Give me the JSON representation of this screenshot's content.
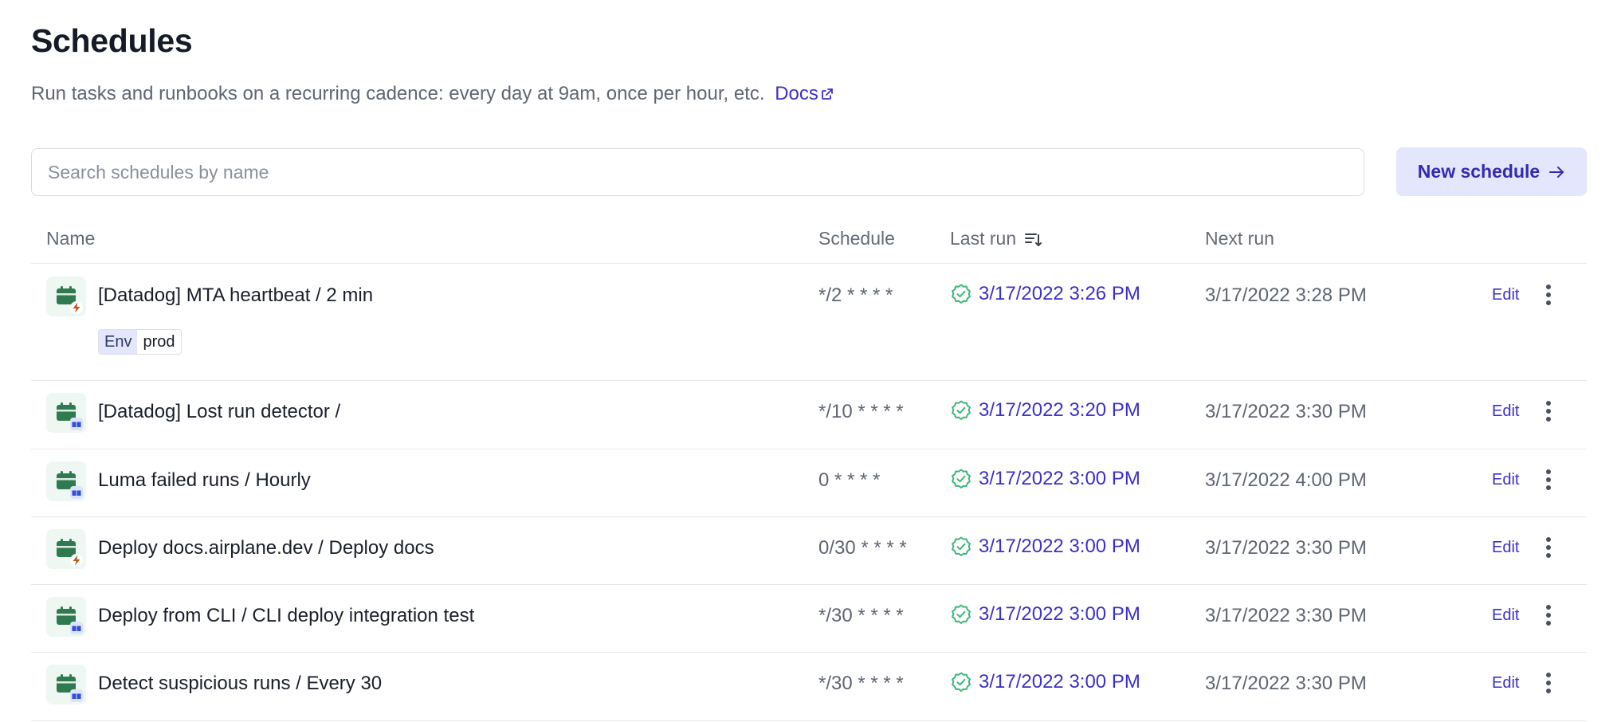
{
  "header": {
    "title": "Schedules",
    "subtitle": "Run tasks and runbooks on a recurring cadence: every day at 9am, once per hour, etc.",
    "docs_link": "Docs"
  },
  "search": {
    "placeholder": "Search schedules by name",
    "value": ""
  },
  "new_schedule_button": "New schedule",
  "colors": {
    "accent": "#3b30c9",
    "button_bg": "#e3e6fc",
    "success": "#3cb878",
    "icon_green": "#2f7a4f",
    "task_badge": "#c0561a",
    "runbook_badge": "#2f4fd6"
  },
  "table": {
    "columns": [
      "Name",
      "Schedule",
      "Last run",
      "Next run"
    ],
    "sort_icon": "sort-descending-icon",
    "rows": [
      {
        "name": "[Datadog] MTA heartbeat / 2 min",
        "kind": "task",
        "badge_icon": "lightning-icon",
        "schedule": "*/2 * * * *",
        "last_run": "3/17/2022 3:26 PM",
        "last_run_status": "success",
        "next_run": "3/17/2022 3:28 PM",
        "edit_label": "Edit",
        "tag": {
          "key": "Env",
          "value": "prod"
        }
      },
      {
        "name": "[Datadog] Lost run detector /",
        "kind": "runbook",
        "badge_icon": "book-icon",
        "schedule": "*/10 * * * *",
        "last_run": "3/17/2022 3:20 PM",
        "last_run_status": "success",
        "next_run": "3/17/2022 3:30 PM",
        "edit_label": "Edit"
      },
      {
        "name": "Luma failed runs / Hourly",
        "kind": "runbook",
        "badge_icon": "book-icon",
        "schedule": "0 * * * *",
        "last_run": "3/17/2022 3:00 PM",
        "last_run_status": "success",
        "next_run": "3/17/2022 4:00 PM",
        "edit_label": "Edit"
      },
      {
        "name": "Deploy docs.airplane.dev / Deploy docs",
        "kind": "task",
        "badge_icon": "lightning-icon",
        "schedule": "0/30 * * * *",
        "last_run": "3/17/2022 3:00 PM",
        "last_run_status": "success",
        "next_run": "3/17/2022 3:30 PM",
        "edit_label": "Edit"
      },
      {
        "name": "Deploy from CLI / CLI deploy integration test",
        "kind": "runbook",
        "badge_icon": "book-icon",
        "schedule": "*/30 * * * *",
        "last_run": "3/17/2022 3:00 PM",
        "last_run_status": "success",
        "next_run": "3/17/2022 3:30 PM",
        "edit_label": "Edit"
      },
      {
        "name": "Detect suspicious runs / Every 30",
        "kind": "runbook",
        "badge_icon": "book-icon",
        "schedule": "*/30 * * * *",
        "last_run": "3/17/2022 3:00 PM",
        "last_run_status": "success",
        "next_run": "3/17/2022 3:30 PM",
        "edit_label": "Edit"
      }
    ]
  }
}
